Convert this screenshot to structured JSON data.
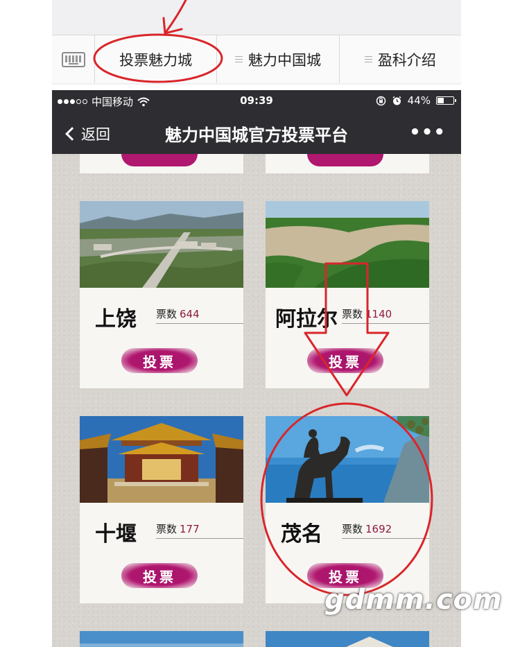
{
  "menu": {
    "items": [
      {
        "label": "投票魅力城"
      },
      {
        "label": "魅力中国城"
      },
      {
        "label": "盈科介绍"
      }
    ]
  },
  "status_bar": {
    "carrier": "中国移动",
    "time": "09:39",
    "battery": "44%",
    "battery_level": 0.44
  },
  "nav": {
    "back_label": "返回",
    "title": "魅力中国城官方投票平台",
    "more_label": "•••"
  },
  "vote_count_label": "票数",
  "vote_button_label": "投票",
  "cities": [
    {
      "name": "上饶",
      "votes": "644"
    },
    {
      "name": "阿拉尔",
      "votes": "1140"
    },
    {
      "name": "十堰",
      "votes": "177"
    },
    {
      "name": "茂名",
      "votes": "1692"
    }
  ],
  "watermark": "gdmm.com",
  "colors": {
    "annotation_red": "#d9252a",
    "vote_button": "#b0176f",
    "vote_number": "#8e1b3f",
    "nav_bar": "#2e2d32"
  }
}
